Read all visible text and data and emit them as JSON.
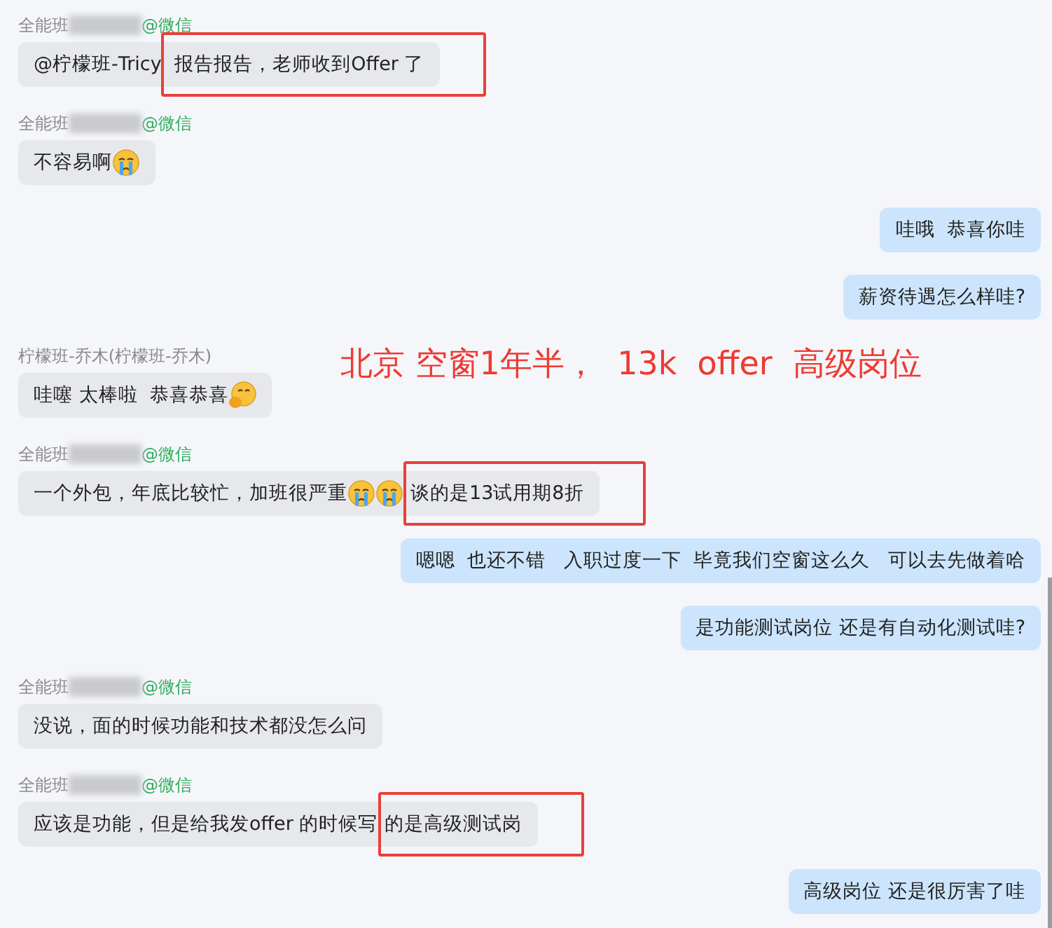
{
  "messages": [
    {
      "kind": "received",
      "sender": {
        "name": "全能班",
        "redacted": true,
        "tag": "@微信"
      },
      "parts": [
        {
          "kind": "text",
          "text": "@柠檬班-Tricy",
          "highlighted": false
        },
        {
          "kind": "text",
          "text": " 报告报告，老师收到Offer 了",
          "highlighted": true
        }
      ]
    },
    {
      "kind": "received",
      "sender": {
        "name": "全能班",
        "redacted": true,
        "tag": "@微信"
      },
      "parts": [
        {
          "kind": "text",
          "text": "不容易啊",
          "highlighted": false
        },
        {
          "kind": "cry"
        }
      ]
    },
    {
      "kind": "sent",
      "parts": [
        {
          "kind": "text",
          "text": "哇哦  恭喜你哇",
          "highlighted": false
        }
      ]
    },
    {
      "kind": "sent",
      "parts": [
        {
          "kind": "text",
          "text": "薪资待遇怎么样哇?",
          "highlighted": false
        }
      ]
    },
    {
      "kind": "received",
      "sender": {
        "name": "柠檬班-乔木(柠檬班-乔木)",
        "redacted": false
      },
      "parts": [
        {
          "kind": "text",
          "text": "哇噻 太棒啦  恭喜恭喜",
          "highlighted": false
        },
        {
          "kind": "bow"
        }
      ]
    },
    {
      "kind": "received",
      "sender": {
        "name": "全能班",
        "redacted": true,
        "tag": "@微信"
      },
      "parts": [
        {
          "kind": "text",
          "text": "一个外包，年底比较忙，加班很严重",
          "highlighted": false
        },
        {
          "kind": "cry"
        },
        {
          "kind": "cry"
        },
        {
          "kind": "text",
          "text": "谈的是13试用期8折",
          "highlighted": true
        }
      ]
    },
    {
      "kind": "sent",
      "parts": [
        {
          "kind": "text",
          "text": "嗯嗯  也还不错   入职过度一下  毕竟我们空窗这么久   可以去先做着哈",
          "highlighted": false
        }
      ]
    },
    {
      "kind": "sent",
      "parts": [
        {
          "kind": "text",
          "text": "是功能测试岗位 还是有自动化测试哇?",
          "highlighted": false
        }
      ]
    },
    {
      "kind": "received",
      "sender": {
        "name": "全能班",
        "redacted": true,
        "tag": "@微信"
      },
      "parts": [
        {
          "kind": "text",
          "text": "没说，面的时候功能和技术都没怎么问",
          "highlighted": false
        }
      ]
    },
    {
      "kind": "received",
      "sender": {
        "name": "全能班",
        "redacted": true,
        "tag": "@微信"
      },
      "parts": [
        {
          "kind": "text",
          "text": "应该是功能，但是给我发offer 的时候写",
          "highlighted": false
        },
        {
          "kind": "text",
          "text": "的是高级测试岗",
          "highlighted": true
        }
      ]
    },
    {
      "kind": "sent",
      "parts": [
        {
          "kind": "text",
          "text": "高级岗位 还是很厉害了哇",
          "highlighted": false
        }
      ]
    }
  ],
  "annotation": "北京 空窗1年半，  13k  offer  高级岗位"
}
